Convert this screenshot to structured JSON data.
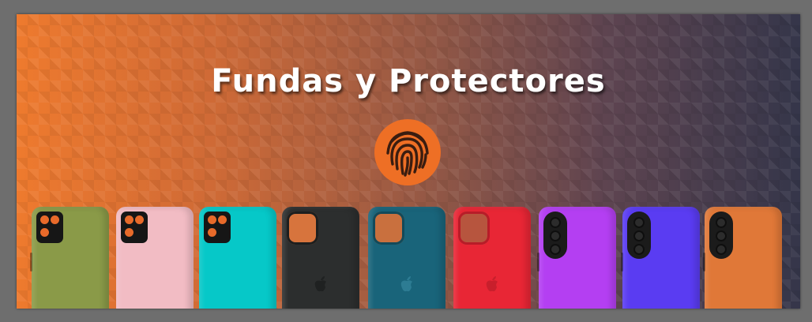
{
  "banner": {
    "title": "Fundas y Protectores",
    "badge_icon": "fingerprint-icon",
    "colors": {
      "gradient_left": "#ee7a2e",
      "gradient_right": "#35364a",
      "badge": "#ee6f25",
      "title": "#ffffff"
    }
  },
  "cases": [
    {
      "name": "case-olive",
      "color": "#8a9a48",
      "camera": "square-orange-lenses",
      "lens_color": "#e86a2a"
    },
    {
      "name": "case-pink",
      "color": "#f2bcc4",
      "camera": "square-orange-lenses",
      "lens_color": "#e86a2a"
    },
    {
      "name": "case-cyan",
      "color": "#06c8c8",
      "camera": "square-orange-lenses",
      "lens_color": "#e86a2a"
    },
    {
      "name": "case-black",
      "color": "#2c2e2e",
      "camera": "iphone-cutout",
      "logo": "apple-icon"
    },
    {
      "name": "case-teal",
      "color": "#19647a",
      "camera": "iphone-cutout",
      "logo": "apple-icon"
    },
    {
      "name": "case-red",
      "color": "#e82635",
      "camera": "iphone-cutout",
      "logo": "apple-icon"
    },
    {
      "name": "case-purple",
      "color": "#b43ff2",
      "camera": "vertical-module"
    },
    {
      "name": "case-blue",
      "color": "#5a3cf2",
      "camera": "vertical-module"
    },
    {
      "name": "case-orange",
      "color": "#e07838",
      "camera": "vertical-module"
    }
  ]
}
